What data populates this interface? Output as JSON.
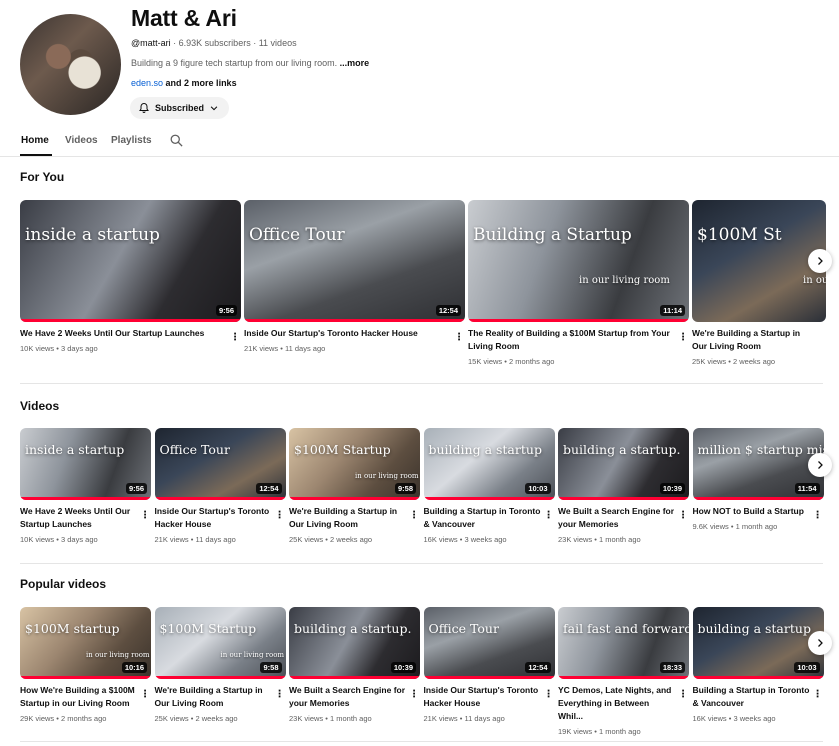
{
  "channel": {
    "name": "Matt & Ari",
    "handle": "@matt-ari",
    "subscribers": "6.93K subscribers",
    "videos_count": "11 videos",
    "description": "Building a 9 figure tech startup from our living room.",
    "more_label": "...more",
    "link": "eden.so",
    "more_links": "and 2 more links",
    "subscribe_label": "Subscribed"
  },
  "tabs": [
    {
      "label": "Home",
      "active": true
    },
    {
      "label": "Videos",
      "active": false
    },
    {
      "label": "Playlists",
      "active": false
    }
  ],
  "sections": [
    {
      "title": "For You",
      "videos": [
        {
          "title": "We Have 2 Weeks Until Our Startup Launches",
          "views": "10K views",
          "age": "3 days ago",
          "duration": "9:56",
          "overlay": "inside a startup",
          "progress": 1.0
        },
        {
          "title": "Inside Our Startup's Toronto Hacker House",
          "views": "21K views",
          "age": "11 days ago",
          "duration": "12:54",
          "overlay": "Office Tour",
          "progress": 1.0
        },
        {
          "title": "The Reality of Building a $100M Startup from Your Living Room",
          "views": "15K views",
          "age": "2 months ago",
          "duration": "11:14",
          "overlay": "Building a Startup",
          "overlay_sub": "in our living room",
          "progress": 1.0
        },
        {
          "title": "We're Building a Startup in Our Living Room",
          "views": "25K views",
          "age": "2 weeks ago",
          "duration": "",
          "overlay": "$100M St",
          "overlay_sub": "in our living r",
          "progress": 0.0
        }
      ]
    },
    {
      "title": "Videos",
      "videos": [
        {
          "title": "We Have 2 Weeks Until Our Startup Launches",
          "views": "10K views",
          "age": "3 days ago",
          "duration": "9:56",
          "overlay": "inside a startup",
          "progress": 1.0
        },
        {
          "title": "Inside Our Startup's Toronto Hacker House",
          "views": "21K views",
          "age": "11 days ago",
          "duration": "12:54",
          "overlay": "Office Tour",
          "progress": 1.0
        },
        {
          "title": "We're Building a Startup in Our Living Room",
          "views": "25K views",
          "age": "2 weeks ago",
          "duration": "9:58",
          "overlay": "$100M Startup",
          "overlay_sub": "in our living room",
          "progress": 1.0
        },
        {
          "title": "Building a Startup in Toronto & Vancouver",
          "views": "16K views",
          "age": "3 weeks ago",
          "duration": "10:03",
          "overlay": "building a startup",
          "progress": 1.0
        },
        {
          "title": "We Built a Search Engine for your Memories",
          "views": "23K views",
          "age": "1 month ago",
          "duration": "10:39",
          "overlay": "building a startup.",
          "progress": 1.0
        },
        {
          "title": "How NOT to Build a Startup",
          "views": "9.6K views",
          "age": "1 month ago",
          "duration": "11:54",
          "overlay": "million $ startup mistakes",
          "progress": 1.0
        }
      ]
    },
    {
      "title": "Popular videos",
      "videos": [
        {
          "title": "How We're Building a $100M Startup in our Living Room",
          "views": "29K views",
          "age": "2 months ago",
          "duration": "10:16",
          "overlay": "$100M startup",
          "overlay_sub": "in our living room",
          "progress": 1.0
        },
        {
          "title": "We're Building a Startup in Our Living Room",
          "views": "25K views",
          "age": "2 weeks ago",
          "duration": "9:58",
          "overlay": "$100M Startup",
          "overlay_sub": "in our living room",
          "progress": 1.0
        },
        {
          "title": "We Built a Search Engine for your Memories",
          "views": "23K views",
          "age": "1 month ago",
          "duration": "10:39",
          "overlay": "building a startup.",
          "progress": 1.0
        },
        {
          "title": "Inside Our Startup's Toronto Hacker House",
          "views": "21K views",
          "age": "11 days ago",
          "duration": "12:54",
          "overlay": "Office Tour",
          "progress": 1.0
        },
        {
          "title": "YC Demos, Late Nights, and Everything in Between Whil...",
          "views": "19K views",
          "age": "1 month ago",
          "duration": "18:33",
          "overlay": "fail fast and forward",
          "progress": 1.0
        },
        {
          "title": "Building a Startup in Toronto & Vancouver",
          "views": "16K views",
          "age": "3 weeks ago",
          "duration": "10:03",
          "overlay": "building a startup",
          "progress": 1.0
        }
      ]
    }
  ],
  "icons": {
    "bell": "bell-icon",
    "chevron": "chevron-down-icon",
    "search": "search-icon",
    "next": "chevron-right-icon",
    "menu": "more-vert-icon"
  },
  "colors": {
    "progress": "#ff0033",
    "link": "#065fd4",
    "meta": "#606060"
  }
}
